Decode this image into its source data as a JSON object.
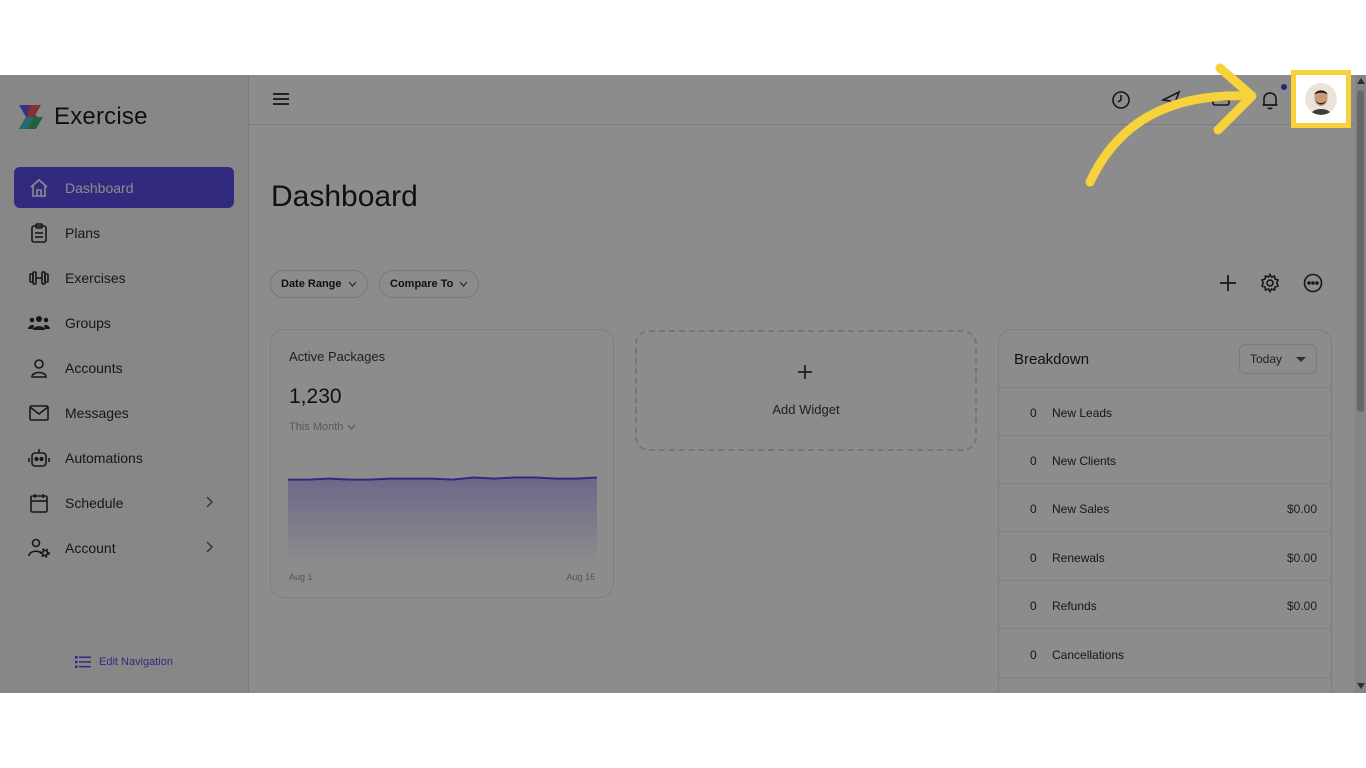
{
  "brand": {
    "name": "Exercise"
  },
  "sidebar": {
    "items": [
      {
        "label": "Dashboard",
        "icon": "home-icon",
        "active": true
      },
      {
        "label": "Plans",
        "icon": "clipboard-icon"
      },
      {
        "label": "Exercises",
        "icon": "dumbbell-icon"
      },
      {
        "label": "Groups",
        "icon": "users-icon"
      },
      {
        "label": "Accounts",
        "icon": "person-icon"
      },
      {
        "label": "Messages",
        "icon": "envelope-icon"
      },
      {
        "label": "Automations",
        "icon": "robot-icon"
      },
      {
        "label": "Schedule",
        "icon": "calendar-icon",
        "has_submenu": true
      },
      {
        "label": "Account",
        "icon": "user-gear-icon",
        "has_submenu": true
      }
    ],
    "edit_nav_label": "Edit Navigation"
  },
  "topbar": {
    "icons": [
      "menu-icon",
      "clock-icon",
      "paper-plane-icon",
      "grid-icon",
      "bell-icon",
      "avatar"
    ],
    "notification_dot": true
  },
  "page": {
    "title": "Dashboard",
    "filters": {
      "date_range": "Date Range",
      "compare_to": "Compare To"
    },
    "tools": [
      "plus-icon",
      "gear-icon",
      "more-icon"
    ]
  },
  "active_packages": {
    "title": "Active Packages",
    "value": "1,230",
    "period": "This Month",
    "x_start": "Aug 1",
    "x_end": "Aug 16"
  },
  "chart_data": {
    "type": "area",
    "x": [
      "Aug 1",
      "Aug 2",
      "Aug 3",
      "Aug 4",
      "Aug 5",
      "Aug 6",
      "Aug 7",
      "Aug 8",
      "Aug 9",
      "Aug 10",
      "Aug 11",
      "Aug 12",
      "Aug 13",
      "Aug 14",
      "Aug 15",
      "Aug 16"
    ],
    "values": [
      1229,
      1229,
      1230,
      1229,
      1229,
      1230,
      1230,
      1230,
      1229,
      1231,
      1230,
      1231,
      1231,
      1230,
      1230,
      1231
    ],
    "ylim": [
      1150,
      1240
    ],
    "color": "#5b4ee8",
    "title": "",
    "xlabel": "",
    "ylabel": ""
  },
  "add_widget": {
    "label": "Add Widget"
  },
  "breakdown": {
    "title": "Breakdown",
    "range": "Today",
    "rows": [
      {
        "count": "0",
        "label": "New Leads",
        "amount": ""
      },
      {
        "count": "0",
        "label": "New Clients",
        "amount": ""
      },
      {
        "count": "0",
        "label": "New Sales",
        "amount": "$0.00"
      },
      {
        "count": "0",
        "label": "Renewals",
        "amount": "$0.00"
      },
      {
        "count": "0",
        "label": "Refunds",
        "amount": "$0.00"
      },
      {
        "count": "0",
        "label": "Cancellations",
        "amount": ""
      }
    ]
  },
  "colors": {
    "accent": "#5b4ee8",
    "highlight": "#f8d23a"
  }
}
